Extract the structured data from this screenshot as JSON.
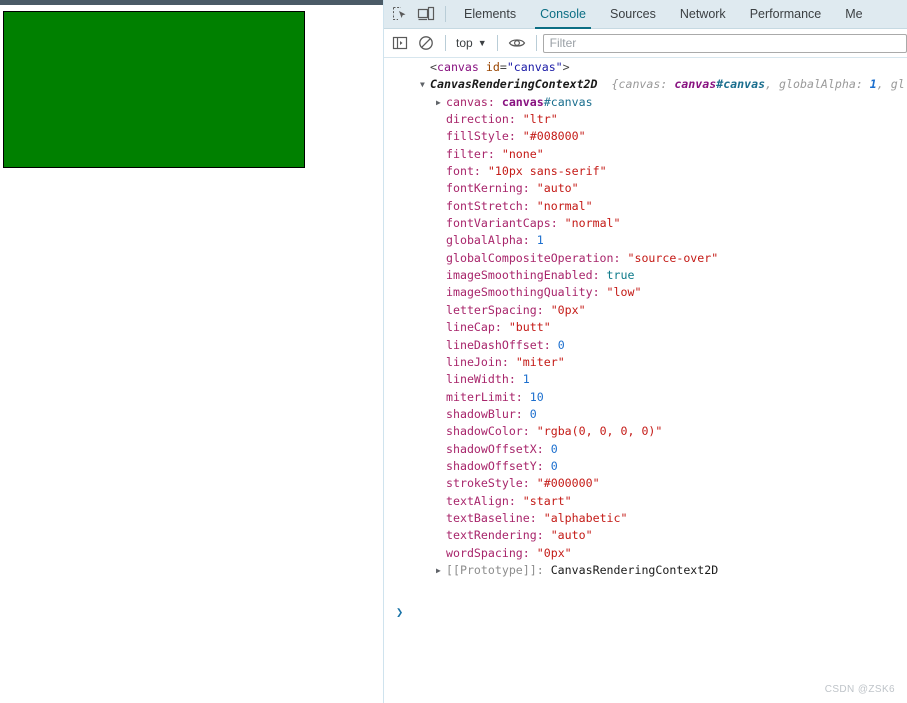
{
  "page": {
    "canvas": {
      "name": "canvas-element",
      "fill_color": "#008000",
      "border_color": "#000000"
    }
  },
  "devtools": {
    "toolbar_icons": [
      {
        "name": "inspect-element-icon",
        "label": "Inspect element"
      },
      {
        "name": "device-toolbar-icon",
        "label": "Toggle device toolbar"
      }
    ],
    "tabs": [
      {
        "label": "Elements",
        "active": false
      },
      {
        "label": "Console",
        "active": true
      },
      {
        "label": "Sources",
        "active": false
      },
      {
        "label": "Network",
        "active": false
      },
      {
        "label": "Performance",
        "active": false
      },
      {
        "label": "Me",
        "active": false
      }
    ],
    "console_toolbar": {
      "sidebar_icon": "console-sidebar-icon",
      "clear_icon": "clear-console-icon",
      "context_value": "top",
      "caret": "▼",
      "eye_icon": "live-expression-eye-icon",
      "filter_placeholder": "Filter",
      "filter_value": ""
    },
    "prompt": {
      "caret": "❯"
    },
    "watermark": "CSDN @ZSK6"
  },
  "console": {
    "html_line": {
      "lt": "<",
      "tag": "canvas",
      "space": " ",
      "attr": "id",
      "eq": "=",
      "attrval": "\"canvas\"",
      "gt": ">"
    },
    "object_header": {
      "arrow": "▼",
      "name": "CanvasRenderingContext2D",
      "preview_open": "{canvas: ",
      "preview_node": "canvas",
      "preview_nodeid": "#canvas",
      "preview_mid": ", globalAlpha: ",
      "preview_num": "1",
      "preview_tail": ", gl"
    },
    "canvas_row": {
      "arrow": "▶",
      "key": "canvas: ",
      "node": "canvas",
      "nodeid": "#canvas"
    },
    "properties": [
      {
        "key": "direction: ",
        "value": "\"ltr\"",
        "type": "string"
      },
      {
        "key": "fillStyle: ",
        "value": "\"#008000\"",
        "type": "string"
      },
      {
        "key": "filter: ",
        "value": "\"none\"",
        "type": "string"
      },
      {
        "key": "font: ",
        "value": "\"10px sans-serif\"",
        "type": "string"
      },
      {
        "key": "fontKerning: ",
        "value": "\"auto\"",
        "type": "string"
      },
      {
        "key": "fontStretch: ",
        "value": "\"normal\"",
        "type": "string"
      },
      {
        "key": "fontVariantCaps: ",
        "value": "\"normal\"",
        "type": "string"
      },
      {
        "key": "globalAlpha: ",
        "value": "1",
        "type": "number"
      },
      {
        "key": "globalCompositeOperation: ",
        "value": "\"source-over\"",
        "type": "string"
      },
      {
        "key": "imageSmoothingEnabled: ",
        "value": "true",
        "type": "boolean"
      },
      {
        "key": "imageSmoothingQuality: ",
        "value": "\"low\"",
        "type": "string"
      },
      {
        "key": "letterSpacing: ",
        "value": "\"0px\"",
        "type": "string"
      },
      {
        "key": "lineCap: ",
        "value": "\"butt\"",
        "type": "string"
      },
      {
        "key": "lineDashOffset: ",
        "value": "0",
        "type": "number"
      },
      {
        "key": "lineJoin: ",
        "value": "\"miter\"",
        "type": "string"
      },
      {
        "key": "lineWidth: ",
        "value": "1",
        "type": "number"
      },
      {
        "key": "miterLimit: ",
        "value": "10",
        "type": "number"
      },
      {
        "key": "shadowBlur: ",
        "value": "0",
        "type": "number"
      },
      {
        "key": "shadowColor: ",
        "value": "\"rgba(0, 0, 0, 0)\"",
        "type": "string"
      },
      {
        "key": "shadowOffsetX: ",
        "value": "0",
        "type": "number"
      },
      {
        "key": "shadowOffsetY: ",
        "value": "0",
        "type": "number"
      },
      {
        "key": "strokeStyle: ",
        "value": "\"#000000\"",
        "type": "string"
      },
      {
        "key": "textAlign: ",
        "value": "\"start\"",
        "type": "string"
      },
      {
        "key": "textBaseline: ",
        "value": "\"alphabetic\"",
        "type": "string"
      },
      {
        "key": "textRendering: ",
        "value": "\"auto\"",
        "type": "string"
      },
      {
        "key": "wordSpacing: ",
        "value": "\"0px\"",
        "type": "string"
      }
    ],
    "prototype_row": {
      "arrow": "▶",
      "key": "[[Prototype]]: ",
      "value": "CanvasRenderingContext2D"
    }
  }
}
